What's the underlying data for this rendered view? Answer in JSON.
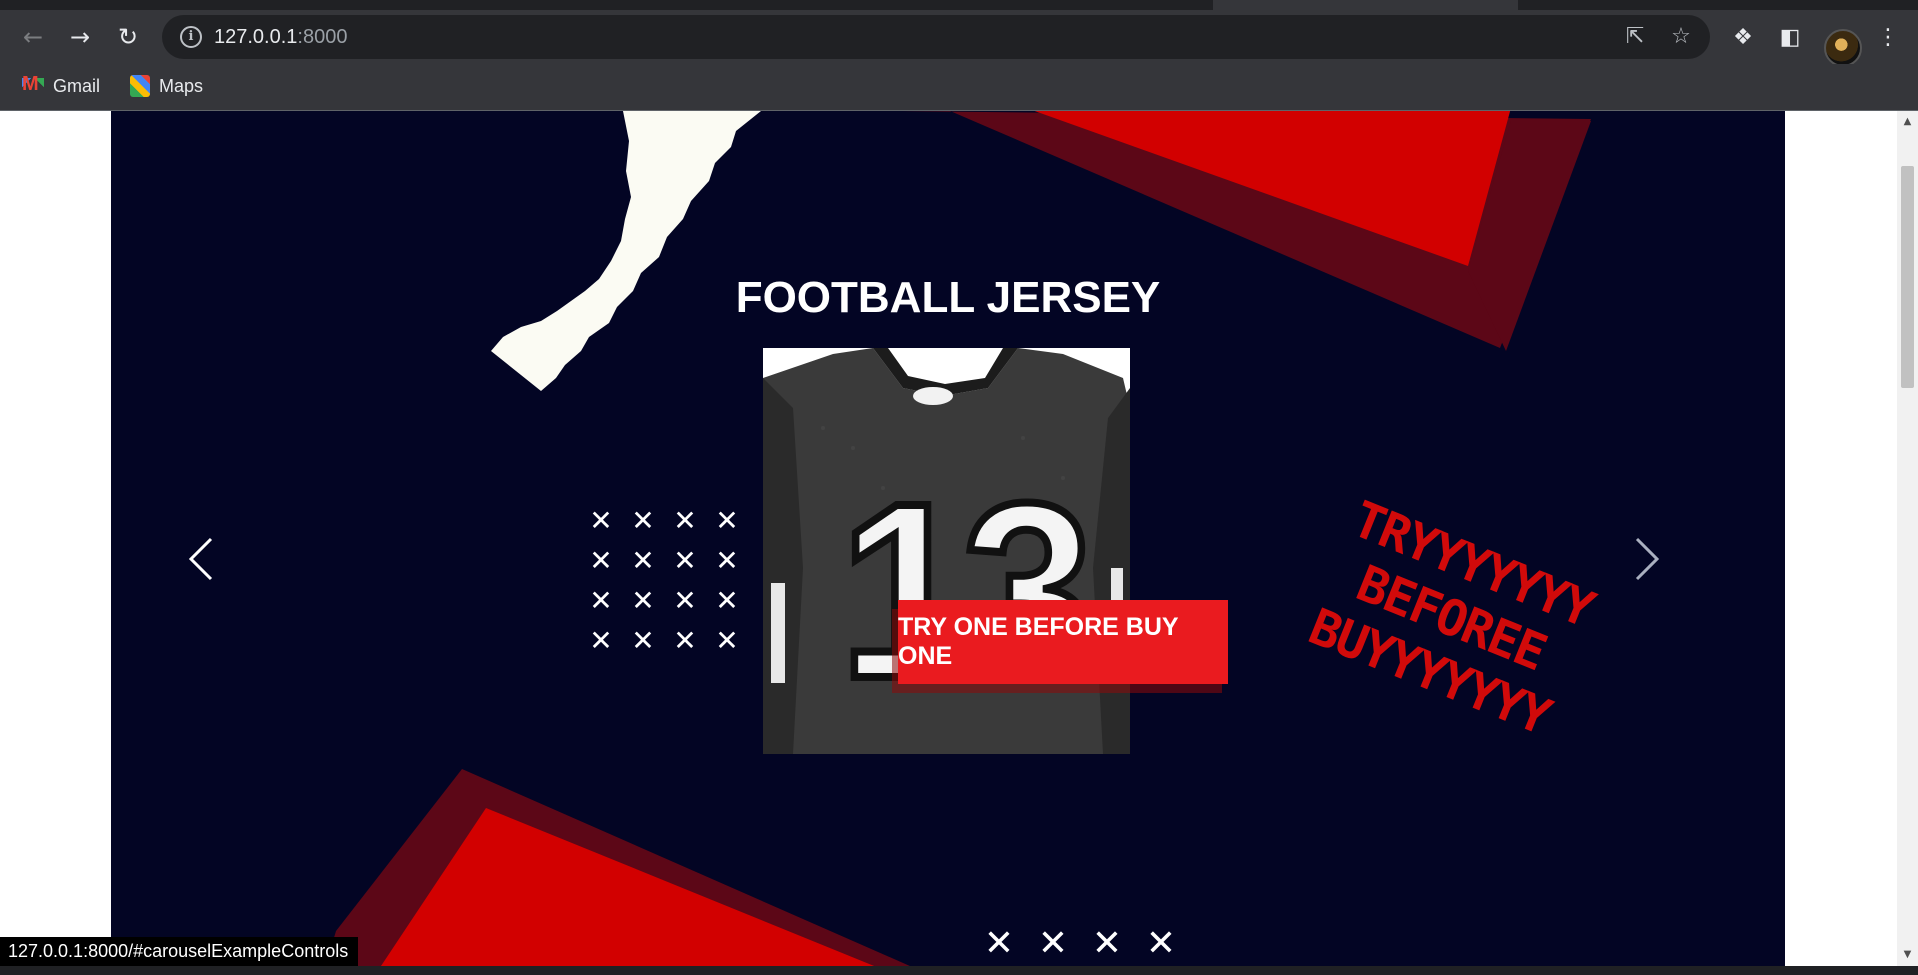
{
  "browser": {
    "url_host": "127.0.0.1",
    "url_port": ":8000",
    "bookmarks": [
      {
        "label": "Gmail",
        "icon": "gmail-icon"
      },
      {
        "label": "Maps",
        "icon": "maps-icon"
      }
    ],
    "status_url": "127.0.0.1:8000/#carouselExampleControls"
  },
  "carousel": {
    "title": "FOOTBALL JERSEY",
    "jersey_number": "13",
    "cta_label": "TRY ONE BEFORE BUY ONE",
    "promo_lines": [
      "TRYYYYYYY",
      "BEFOREE",
      "BUYYYYYYY"
    ],
    "x_mark": "✕",
    "prev_icon": "chevron-left-icon",
    "next_icon": "chevron-right-icon"
  },
  "colors": {
    "carousel_bg": "#030524",
    "accent_red": "#d20000",
    "accent_dark_red": "#5c0717",
    "cta_red": "#ea1b1f",
    "paper": "#fbfbf3"
  }
}
